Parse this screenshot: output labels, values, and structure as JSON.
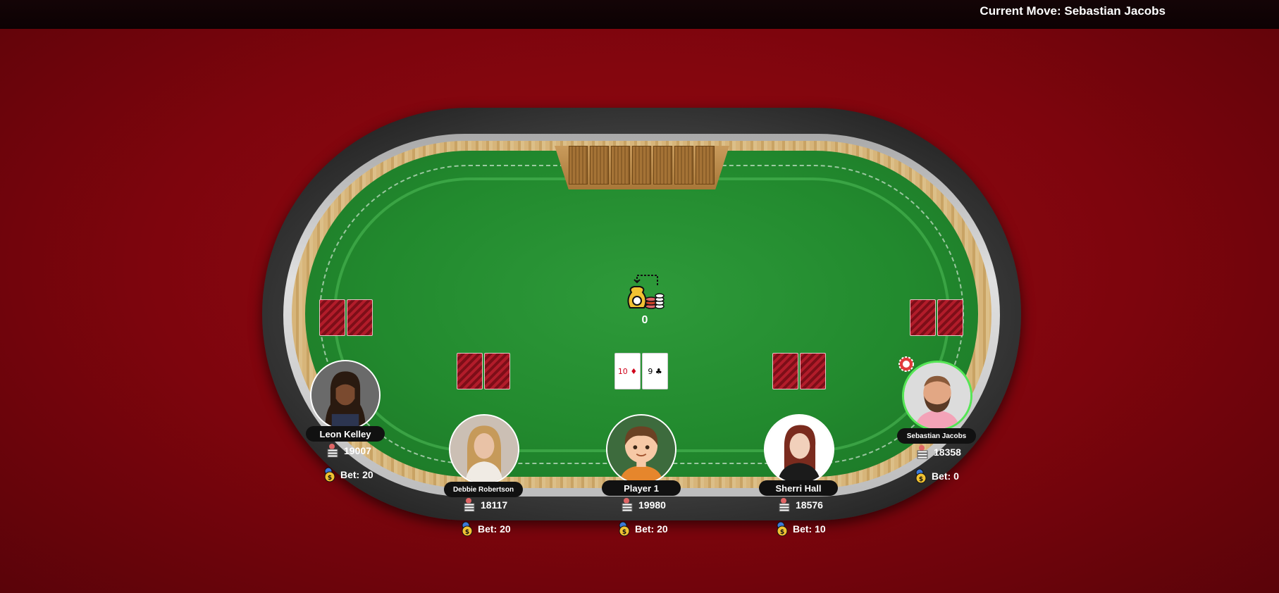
{
  "header": {
    "current_move": "Current Move: Sebastian Jacobs"
  },
  "pot": {
    "value": "0",
    "icon": "pot-money-icon"
  },
  "community_cards": [
    {
      "rank": "10",
      "suit": "♦",
      "color": "#d0021b"
    },
    {
      "rank": "9",
      "suit": "♣",
      "color": "#000000"
    }
  ],
  "players": [
    {
      "name": "Leon Kelley",
      "chips": "19007",
      "bet": "Bet: 20",
      "active": false,
      "face_colors": {
        "skin": "#7a4a2f",
        "hair": "#2a1a10",
        "bg": "#6a6a6a"
      }
    },
    {
      "name": "Debbie Robertson",
      "chips": "18117",
      "bet": "Bet: 20",
      "active": false,
      "face_colors": {
        "skin": "#e9c2a6",
        "hair": "#c69a5a",
        "bg": "#cbbfb4"
      }
    },
    {
      "name": "Player 1",
      "chips": "19980",
      "bet": "Bet: 20",
      "active": false,
      "face_colors": {
        "skin": "#f7c9a6",
        "hair": "#6b4224",
        "bg": "#3d6b3d"
      }
    },
    {
      "name": "Sherri Hall",
      "chips": "18576",
      "bet": "Bet: 10",
      "active": false,
      "face_colors": {
        "skin": "#f1d0bb",
        "hair": "#7a2b1e",
        "bg": "#ffffff"
      }
    },
    {
      "name": "Sebastian Jacobs",
      "chips": "18358",
      "bet": "Bet: 0",
      "active": true,
      "face_colors": {
        "skin": "#e2a784",
        "hair": "#5a3a26",
        "bg": "#dcdcdc"
      }
    }
  ],
  "colors": {
    "background": "#8b0510",
    "felt": "#228a2e",
    "active_ring": "#55e655",
    "card_back": "#b21c2a"
  }
}
